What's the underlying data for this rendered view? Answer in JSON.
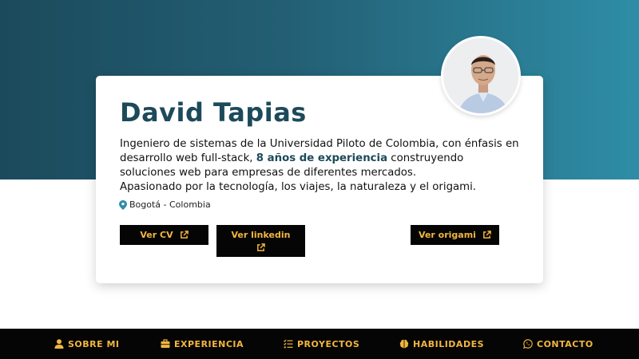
{
  "profile": {
    "name": "David Tapias",
    "bio_part1": "Ingeniero de sistemas de la Universidad Piloto de Colombia, con énfasis en desarrollo web full-stack, ",
    "bio_highlight": "8 años de experiencia",
    "bio_part2": " construyendo soluciones web para empresas de diferentes mercados.",
    "bio_line2": "Apasionado por la tecnología, los viajes, la naturaleza y el origami.",
    "location": "Bogotá - Colombia"
  },
  "buttons": {
    "cv": "Ver CV",
    "linkedin": "Ver linkedin",
    "origami": "Ver origami"
  },
  "nav": {
    "items": [
      {
        "label": "SOBRE MI",
        "icon": "user-icon"
      },
      {
        "label": "EXPERIENCIA",
        "icon": "briefcase-icon"
      },
      {
        "label": "PROYECTOS",
        "icon": "list-check-icon"
      },
      {
        "label": "HABILIDADES",
        "icon": "brain-icon"
      },
      {
        "label": "CONTACTO",
        "icon": "whatsapp-icon"
      }
    ]
  },
  "colors": {
    "accent": "#f2b640",
    "heading": "#1c4a5a",
    "hero_start": "#1b4a5c",
    "hero_end": "#2e8da6"
  }
}
